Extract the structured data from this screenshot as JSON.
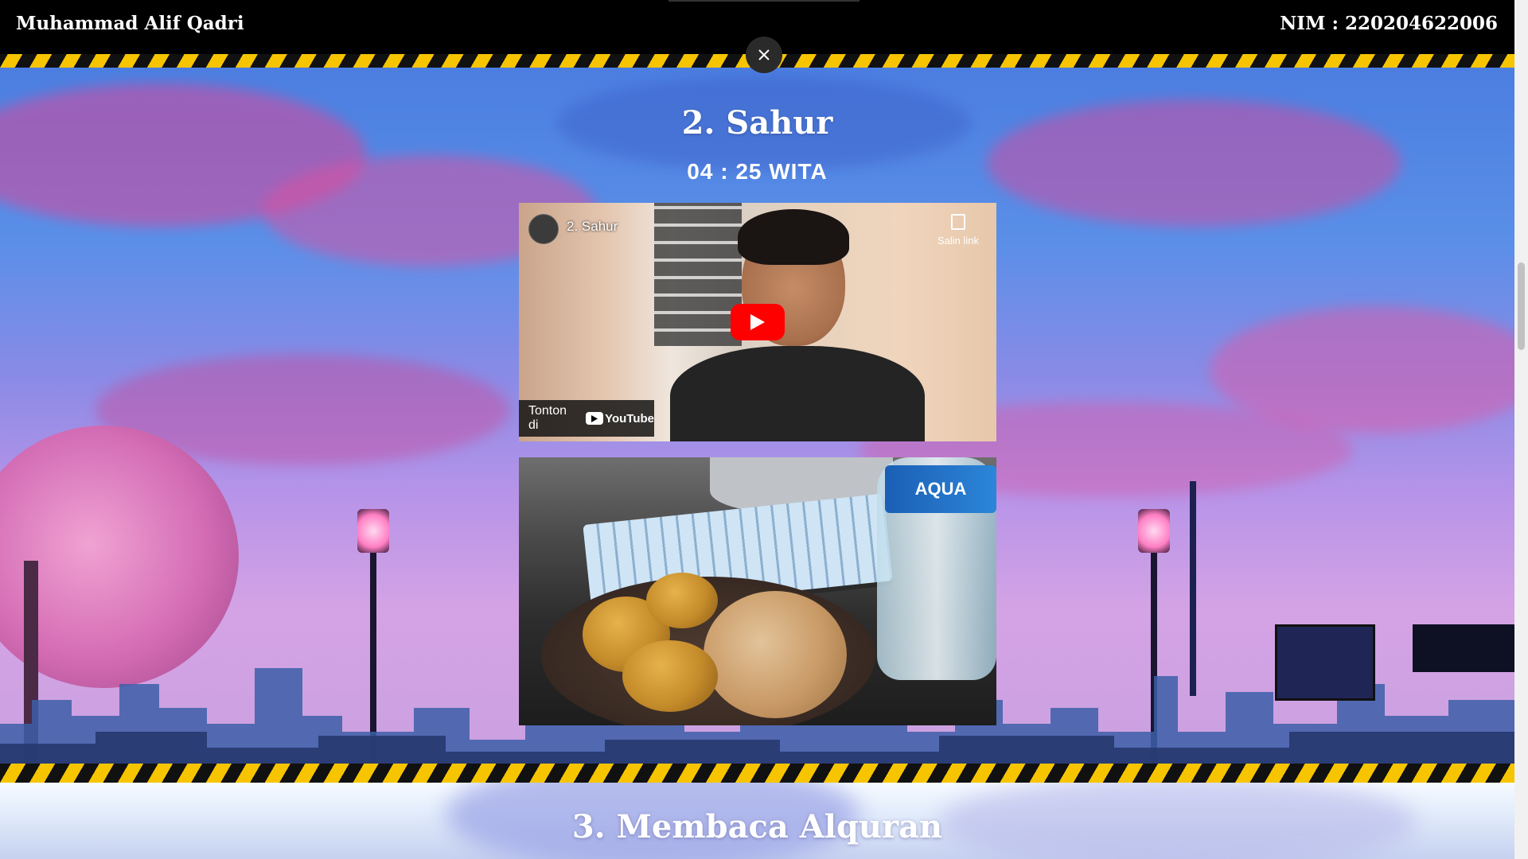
{
  "header": {
    "name": "Muhammad Alif Qadri",
    "nim": "NIM : 220204622006"
  },
  "section": {
    "title": "2. Sahur",
    "time": "04 : 25 WITA"
  },
  "video": {
    "title": "2. Sahur",
    "copy_link_label": "Salin link",
    "watch_on_label": "Tonton di",
    "youtube_label": "YouTube"
  },
  "photo": {
    "bottle_brand": "AQUA"
  },
  "next_section": {
    "title": "3. Membaca Alquran"
  },
  "colors": {
    "hazard_yellow": "#f7c400",
    "hazard_black": "#111111",
    "header_bg": "#000000",
    "youtube_red": "#ff0000"
  },
  "icons": {
    "close": "close-icon",
    "play": "play-icon",
    "copy": "copy-link-icon",
    "youtube": "youtube-logo-icon"
  }
}
